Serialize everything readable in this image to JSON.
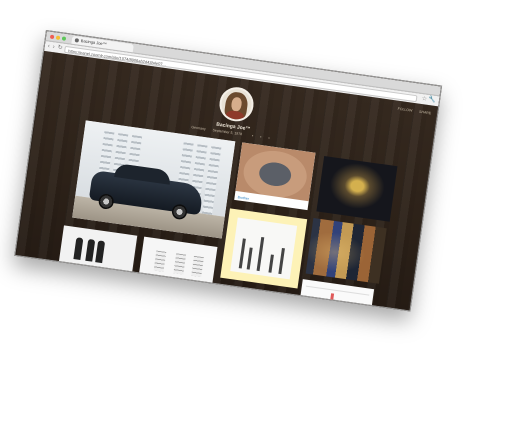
{
  "browser": {
    "tab_title": "Bacinga Joe™",
    "url": "https://panel.zoomlr.com/site/1074/8906ab2d43b4e07...",
    "back_icon": "arrow-left-icon",
    "forward_icon": "arrow-right-icon",
    "reload_icon": "reload-icon",
    "bookmark_icon": "star-icon",
    "menu_icon": "wrench-icon"
  },
  "page": {
    "top_links": [
      "FOLLOW",
      "SHARE"
    ],
    "profile": {
      "name": "Bacinga Joe™",
      "location": "Germany",
      "joined": "September 5, 1978",
      "social_icons": [
        "facebook-icon",
        "twitter-icon",
        "rss-icon"
      ]
    },
    "tiles": [
      {
        "kind": "photo",
        "subject": "car"
      },
      {
        "kind": "photo",
        "subject": "tattoo",
        "caption": "Brother"
      },
      {
        "kind": "photo",
        "subject": "dark"
      },
      {
        "kind": "illustration",
        "subject": "sketch"
      },
      {
        "kind": "photo",
        "subject": "street"
      },
      {
        "kind": "photo",
        "subject": "people"
      },
      {
        "kind": "photo",
        "subject": "building"
      },
      {
        "kind": "document",
        "subject": "chart"
      }
    ],
    "colors": {
      "wood_background": "#2c2118",
      "highlight_tile": "#fdf2b7",
      "caption_link": "#2a7fc1"
    }
  }
}
